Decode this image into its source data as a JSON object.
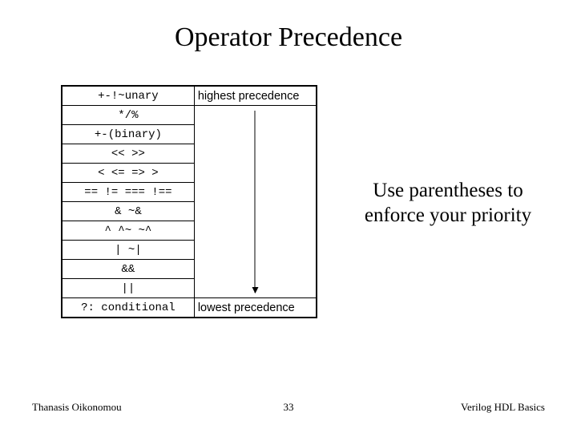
{
  "title": "Operator Precedence",
  "labels": {
    "highest": "highest precedence",
    "lowest": "lowest precedence"
  },
  "rows": [
    "+-!~unary",
    "*/%",
    "+-(binary)",
    "<< >>",
    "< <= => >",
    "== != === !==",
    "& ~&",
    "^ ^~ ~^",
    "| ~|",
    "&&",
    "||",
    "?: conditional"
  ],
  "note": "Use parentheses to enforce your priority",
  "footer": {
    "author": "Thanasis Oikonomou",
    "page": "33",
    "topic": "Verilog HDL Basics"
  }
}
